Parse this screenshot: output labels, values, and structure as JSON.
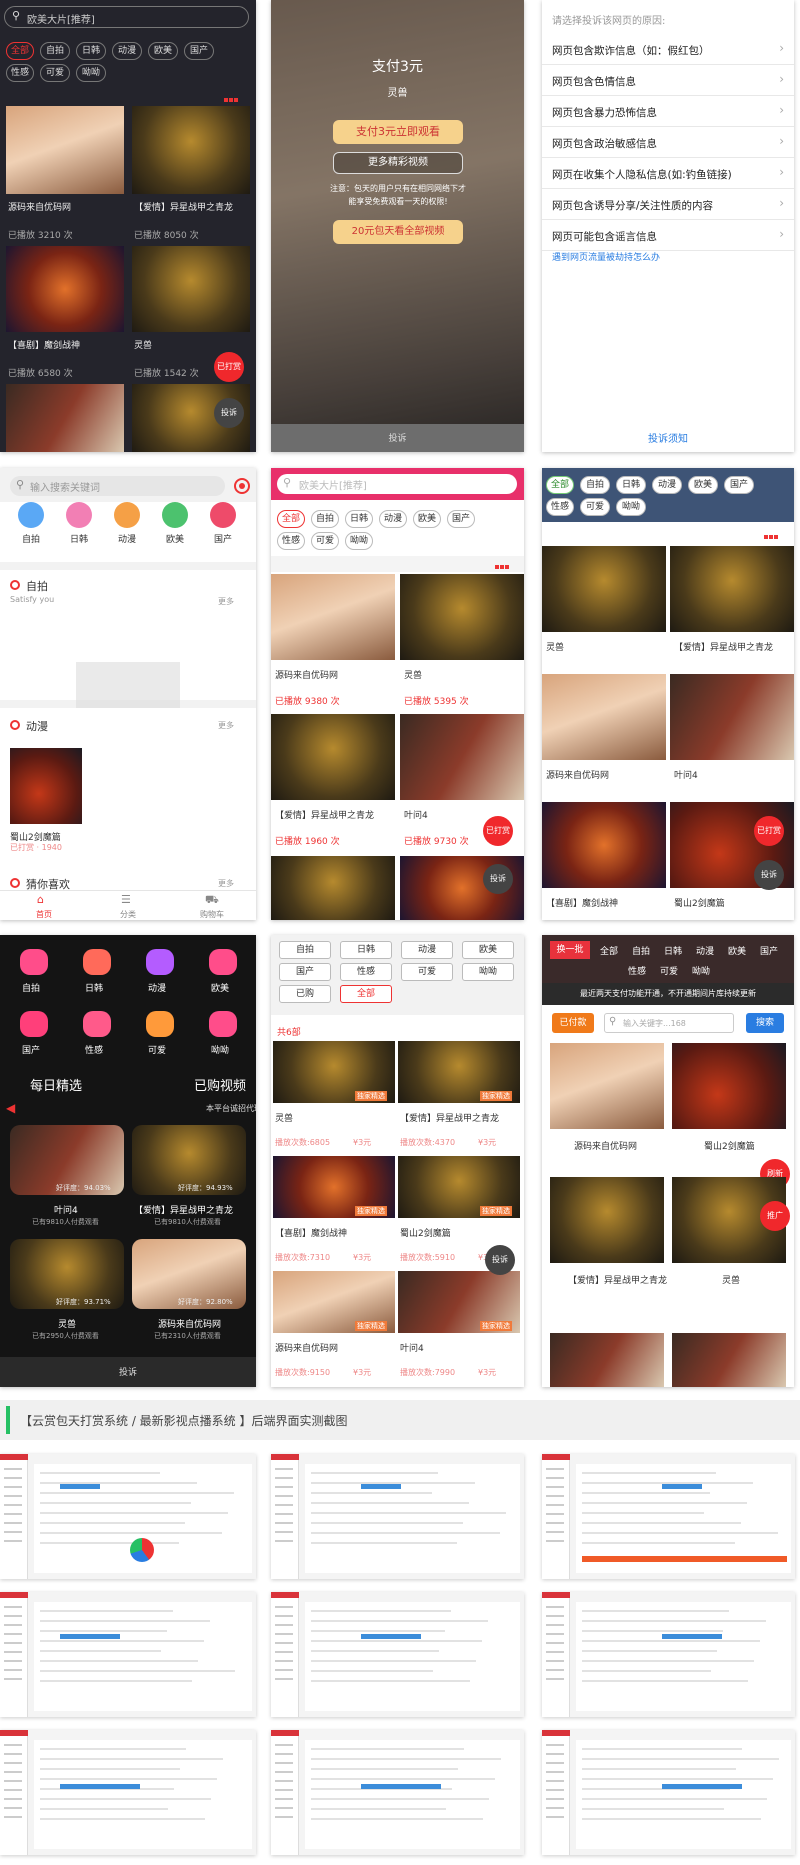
{
  "s1": {
    "search_placeholder": "欧美大片[推荐]",
    "tags": [
      "全部",
      "自拍",
      "日韩",
      "动漫",
      "欧美",
      "国产",
      "性感",
      "可爱",
      "呦呦"
    ],
    "items": [
      {
        "title": "源码来自优码网",
        "plays": "已播放 3210 次"
      },
      {
        "title": "【爱情】异星战甲之青龙",
        "plays": "已播放 8050 次"
      },
      {
        "title": "【喜剧】魔剑战神",
        "plays": "已播放 6580 次"
      },
      {
        "title": "灵兽",
        "plays": "已播放 1542 次"
      }
    ],
    "tip_btn": "已打赏",
    "report_btn": "投诉"
  },
  "s2": {
    "pay_title": "支付3元",
    "pay_sub": "灵兽",
    "pay_btn": "支付3元立即观看",
    "more_btn": "更多精彩视频",
    "notice": "注意：包天的用户只有在相同网络下才能享受免费观看一天的权限!",
    "vip_btn": "20元包天看全部视频",
    "footer": "投诉"
  },
  "s3": {
    "prompt": "请选择投诉该网页的原因:",
    "reasons": [
      "网页包含欺诈信息（如：假红包）",
      "网页包含色情信息",
      "网页包含暴力恐怖信息",
      "网页包含政治敏感信息",
      "网页在收集个人隐私信息(如:钓鱼链接)",
      "网页包含诱导分享/关注性质的内容",
      "网页可能包含谣言信息"
    ],
    "link": "遇到网页流量被劫持怎么办",
    "footer_link": "投诉须知"
  },
  "s4": {
    "search_placeholder": "输入搜索关键词",
    "cats": [
      "自拍",
      "日韩",
      "动漫",
      "欧美",
      "国产"
    ],
    "sec1_title": "自拍",
    "sec1_sub": "Satisfy you",
    "more": "更多",
    "sec2_title": "动漫",
    "item_title": "蜀山2剑魔篇",
    "item_meta": "已打赏 · 1940",
    "sec3_title": "猜你喜欢",
    "nav": [
      "首页",
      "分类",
      "购物车"
    ]
  },
  "s5": {
    "search_placeholder": "欧美大片[推荐]",
    "tags": [
      "全部",
      "自拍",
      "日韩",
      "动漫",
      "欧美",
      "国产",
      "性感",
      "可爱",
      "呦呦"
    ],
    "items": [
      {
        "title": "源码来自优码网",
        "plays": "已播放 9380 次"
      },
      {
        "title": "灵兽",
        "plays": "已播放 5395 次"
      },
      {
        "title": "【爱情】异星战甲之青龙",
        "plays": "已播放 1960 次"
      },
      {
        "title": "叶问4",
        "plays": "已播放 9730 次"
      }
    ],
    "tip_btn": "已打赏",
    "report_btn": "投诉"
  },
  "s6": {
    "tags": [
      "全部",
      "自拍",
      "日韩",
      "动漫",
      "欧美",
      "国产",
      "性感",
      "可爱",
      "呦呦"
    ],
    "items": [
      {
        "title": "灵兽"
      },
      {
        "title": "【爱情】异星战甲之青龙"
      },
      {
        "title": "源码来自优码网"
      },
      {
        "title": "叶问4"
      },
      {
        "title": "【喜剧】魔剑战神"
      },
      {
        "title": "蜀山2剑魔篇"
      }
    ],
    "tip_btn": "已打赏",
    "report_btn": "投诉"
  },
  "s7": {
    "cats": [
      "自拍",
      "日韩",
      "动漫",
      "欧美",
      "国产",
      "性感",
      "可爱",
      "呦呦"
    ],
    "daily": "每日精选",
    "bought": "已购视频",
    "marquee": "本平台诚招代理",
    "items": [
      {
        "title": "叶问4",
        "meta": "已有9810人付费观看",
        "score": "好评度：94.03%"
      },
      {
        "title": "【爱情】异星战甲之青龙",
        "meta": "已有9810人付费观看",
        "score": "好评度：94.93%"
      },
      {
        "title": "灵兽",
        "meta": "已有2950人付费观看",
        "score": "好评度：93.71%"
      },
      {
        "title": "源码来自优码网",
        "meta": "已有2310人付费观看",
        "score": "好评度：92.80%"
      }
    ],
    "footer": "投诉"
  },
  "s8": {
    "filters": [
      "自拍",
      "日韩",
      "动漫",
      "欧美",
      "国产",
      "性感",
      "可爱",
      "呦呦",
      "已购",
      "全部"
    ],
    "count": "共6部",
    "badge": "独家精选",
    "items": [
      {
        "title": "灵兽",
        "plays": "播放次数:6805",
        "price": "¥3元"
      },
      {
        "title": "【爱情】异星战甲之青龙",
        "plays": "播放次数:4370",
        "price": "¥3元"
      },
      {
        "title": "【喜剧】魔剑战神",
        "plays": "播放次数:7310",
        "price": "¥3元"
      },
      {
        "title": "蜀山2剑魔篇",
        "plays": "播放次数:5910",
        "price": "¥3元"
      },
      {
        "title": "源码来自优码网",
        "plays": "播放次数:9150",
        "price": "¥3元"
      },
      {
        "title": "叶问4",
        "plays": "播放次数:7990",
        "price": "¥3元"
      }
    ],
    "report_btn": "投诉"
  },
  "s9": {
    "tabs": [
      "换一批",
      "全部",
      "自拍",
      "日韩",
      "动漫",
      "欧美",
      "国产",
      "性感",
      "可爱",
      "呦呦"
    ],
    "notice": "最近两天支付功能开通，不开通期间片库持续更新",
    "paid_btn": "已付款",
    "search_placeholder": "输入关键字...168",
    "search_btn": "搜索",
    "items": [
      "源码来自优码网",
      "蜀山2剑魔篇",
      "【爱情】异星战甲之青龙",
      "灵兽"
    ],
    "refresh_btn": "刷新",
    "promo_btn": "推广"
  },
  "banner": "【云赏包天打赏系统 / 最新影视点播系统 】后端界面实测截图",
  "colors": {
    "accent": "#e8323c",
    "dark": "#24242c",
    "green_banner": "#26c064",
    "blue": "#2a7de1"
  }
}
